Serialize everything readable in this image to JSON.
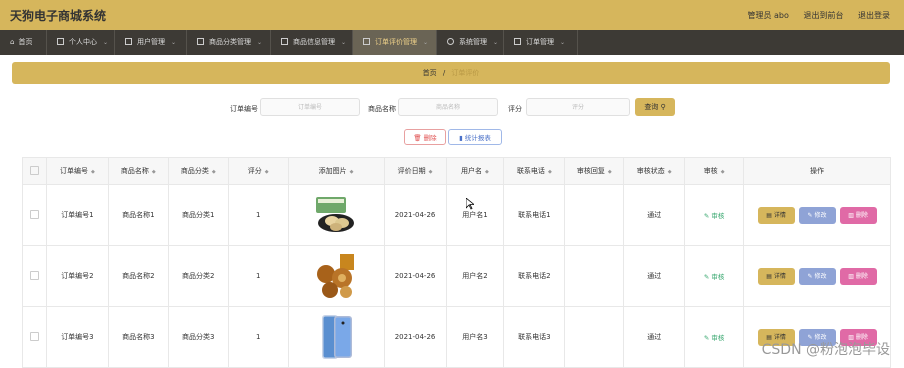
{
  "app": {
    "title": "天狗电子商城系统"
  },
  "user": {
    "role_label": "管理员 abo",
    "back_link": "退出到前台",
    "logout": "退出登录"
  },
  "nav": {
    "home": "首页",
    "items": [
      "个人中心",
      "用户管理",
      "商品分类管理",
      "商品信息管理",
      "订单评价管理",
      "系统管理",
      "订单管理"
    ]
  },
  "breadcrumb": {
    "home": "首页",
    "sep": "/",
    "current": "订单评价"
  },
  "search": {
    "order_label": "订单编号",
    "order_placeholder": "订单编号",
    "product_label": "商品名称",
    "product_placeholder": "商品名称",
    "score_label": "评分",
    "score_placeholder": "评分",
    "button": "查询"
  },
  "actions": {
    "delete": "删除",
    "stats": "统计报表"
  },
  "table": {
    "headers": [
      "订单编号",
      "商品名称",
      "商品分类",
      "评分",
      "添加图片",
      "评价日期",
      "用户名",
      "联系电话",
      "审核回复",
      "审核状态",
      "审核",
      "操作"
    ],
    "rows": [
      {
        "order": "订单编号1",
        "product": "商品名称1",
        "category": "商品分类1",
        "score": "1",
        "date": "2021-04-26",
        "user": "用户名1",
        "phone": "联系电话1",
        "reply": "",
        "status": "通过",
        "review": "审核"
      },
      {
        "order": "订单编号2",
        "product": "商品名称2",
        "category": "商品分类2",
        "score": "1",
        "date": "2021-04-26",
        "user": "用户名2",
        "phone": "联系电话2",
        "reply": "",
        "status": "通过",
        "review": "审核"
      },
      {
        "order": "订单编号3",
        "product": "商品名称3",
        "category": "商品分类3",
        "score": "1",
        "date": "2021-04-26",
        "user": "用户名3",
        "phone": "联系电话3",
        "reply": "",
        "status": "通过",
        "review": "审核"
      }
    ],
    "ops": {
      "detail": "详情",
      "edit": "修改",
      "delete": "删除"
    }
  },
  "watermark": "CSDN @粉泡泡毕设"
}
